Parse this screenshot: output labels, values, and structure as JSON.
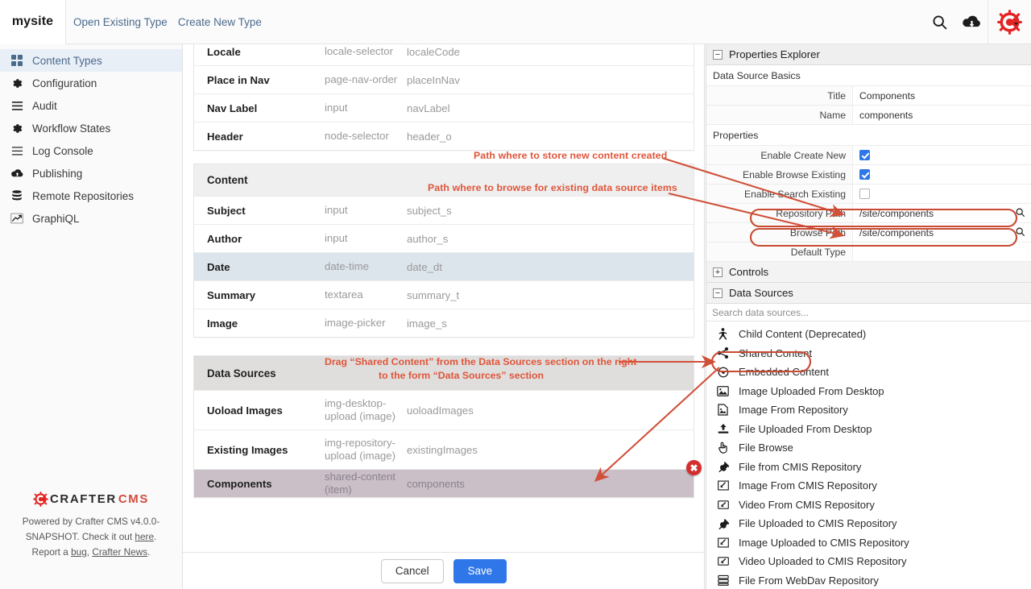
{
  "topbar": {
    "brand": "mysite",
    "nav": [
      {
        "label": "Open Existing Type"
      },
      {
        "label": "Create New Type"
      }
    ],
    "icons": [
      {
        "name": "search-icon"
      },
      {
        "name": "cloud-upload-icon"
      },
      {
        "name": "crafter-logo-icon"
      }
    ]
  },
  "sidebar": {
    "items": [
      {
        "label": "Content Types",
        "icon": "grid-icon",
        "active": true
      },
      {
        "label": "Configuration",
        "icon": "gear-icon",
        "active": false
      },
      {
        "label": "Audit",
        "icon": "list-icon",
        "active": false
      },
      {
        "label": "Workflow States",
        "icon": "gear-icon",
        "active": false
      },
      {
        "label": "Log Console",
        "icon": "list-icon",
        "active": false
      },
      {
        "label": "Publishing",
        "icon": "cloud-upload-icon",
        "active": false
      },
      {
        "label": "Remote Repositories",
        "icon": "database-icon",
        "active": false
      },
      {
        "label": "GraphiQL",
        "icon": "chart-line-icon",
        "active": false
      }
    ],
    "footer": {
      "logo_part1": "CRAFTER",
      "logo_part2": "CMS",
      "text_1": "Powered by Crafter CMS v4.0.0-SNAPSHOT. Check it out ",
      "link_here": "here",
      "text_2": ". Report a ",
      "link_bug": "bug",
      "text_3": ", ",
      "link_news": "Crafter News",
      "text_4": "."
    }
  },
  "form": {
    "top_section": {
      "rows": [
        {
          "label": "Locale",
          "control": "locale-selector",
          "field": "localeCode"
        },
        {
          "label": "Place in Nav",
          "control": "page-nav-order",
          "field": "placeInNav"
        },
        {
          "label": "Nav Label",
          "control": "input",
          "field": "navLabel"
        },
        {
          "label": "Header",
          "control": "node-selector",
          "field": "header_o"
        }
      ]
    },
    "content_section": {
      "title": "Content",
      "rows": [
        {
          "label": "Subject",
          "control": "input",
          "field": "subject_s",
          "highlight": "none"
        },
        {
          "label": "Author",
          "control": "input",
          "field": "author_s",
          "highlight": "none"
        },
        {
          "label": "Date",
          "control": "date-time",
          "field": "date_dt",
          "highlight": "blue"
        },
        {
          "label": "Summary",
          "control": "textarea",
          "field": "summary_t",
          "highlight": "none"
        },
        {
          "label": "Image",
          "control": "image-picker",
          "field": "image_s",
          "highlight": "none"
        }
      ]
    },
    "datasources_section": {
      "title": "Data Sources",
      "rows": [
        {
          "label": "Uoload Images",
          "control": "img-desktop-upload (image)",
          "field": "uoloadImages",
          "highlight": "none"
        },
        {
          "label": "Existing Images",
          "control": "img-repository-upload (image)",
          "field": "existingImages",
          "highlight": "none"
        },
        {
          "label": "Components",
          "control": "shared-content (item)",
          "field": "components",
          "highlight": "mauve"
        }
      ]
    },
    "buttons": {
      "cancel": "Cancel",
      "save": "Save"
    }
  },
  "properties_explorer": {
    "title": "Properties Explorer",
    "basics_label": "Data Source Basics",
    "basics": [
      {
        "label": "Title",
        "value": "Components"
      },
      {
        "label": "Name",
        "value": "components"
      }
    ],
    "properties_label": "Properties",
    "properties": [
      {
        "label": "Enable Create New",
        "type": "checkbox",
        "checked": true
      },
      {
        "label": "Enable Browse Existing",
        "type": "checkbox",
        "checked": true
      },
      {
        "label": "Enable Search Existing",
        "type": "checkbox",
        "checked": false
      },
      {
        "label": "Repository Path",
        "type": "path",
        "value": "/site/components",
        "circled": true
      },
      {
        "label": "Browse Path",
        "type": "path",
        "value": "/site/components",
        "circled": true
      },
      {
        "label": "Default Type",
        "type": "text",
        "value": ""
      }
    ],
    "controls_label": "Controls",
    "datasources_label": "Data Sources",
    "search_placeholder": "Search data sources...",
    "datasource_items": [
      {
        "label": "Child Content (Deprecated)",
        "icon": "person-icon",
        "circled": false
      },
      {
        "label": "Shared Content",
        "icon": "share-icon",
        "circled": true
      },
      {
        "label": "Embedded Content",
        "icon": "dot-circle-icon",
        "circled": false
      },
      {
        "label": "Image Uploaded From Desktop",
        "icon": "image-icon",
        "circled": false
      },
      {
        "label": "Image From Repository",
        "icon": "image-file-icon",
        "circled": false
      },
      {
        "label": "File Uploaded From Desktop",
        "icon": "upload-icon",
        "circled": false
      },
      {
        "label": "File Browse",
        "icon": "hand-pointer-icon",
        "circled": false
      },
      {
        "label": "File from CMIS Repository",
        "icon": "plug-icon",
        "circled": false
      },
      {
        "label": "Image From CMIS Repository",
        "icon": "image-arrow-icon",
        "circled": false
      },
      {
        "label": "Video From CMIS Repository",
        "icon": "video-arrow-icon",
        "circled": false
      },
      {
        "label": "File Uploaded to CMIS Repository",
        "icon": "plug-icon",
        "circled": false
      },
      {
        "label": "Image Uploaded to CMIS Repository",
        "icon": "image-arrow-icon",
        "circled": false
      },
      {
        "label": "Video Uploaded to CMIS Repository",
        "icon": "video-arrow-icon",
        "circled": false
      },
      {
        "label": "File From WebDav Repository",
        "icon": "server-icon",
        "circled": false
      }
    ]
  },
  "annotations": {
    "accent_color": "#e0553a",
    "note_store": "Path where to store new content created",
    "note_browse": "Path where to browse for existing data source items",
    "note_drag_line1": "Drag “Shared Content” from the Data Sources section on the right",
    "note_drag_line2": "to the form “Data Sources” section"
  }
}
